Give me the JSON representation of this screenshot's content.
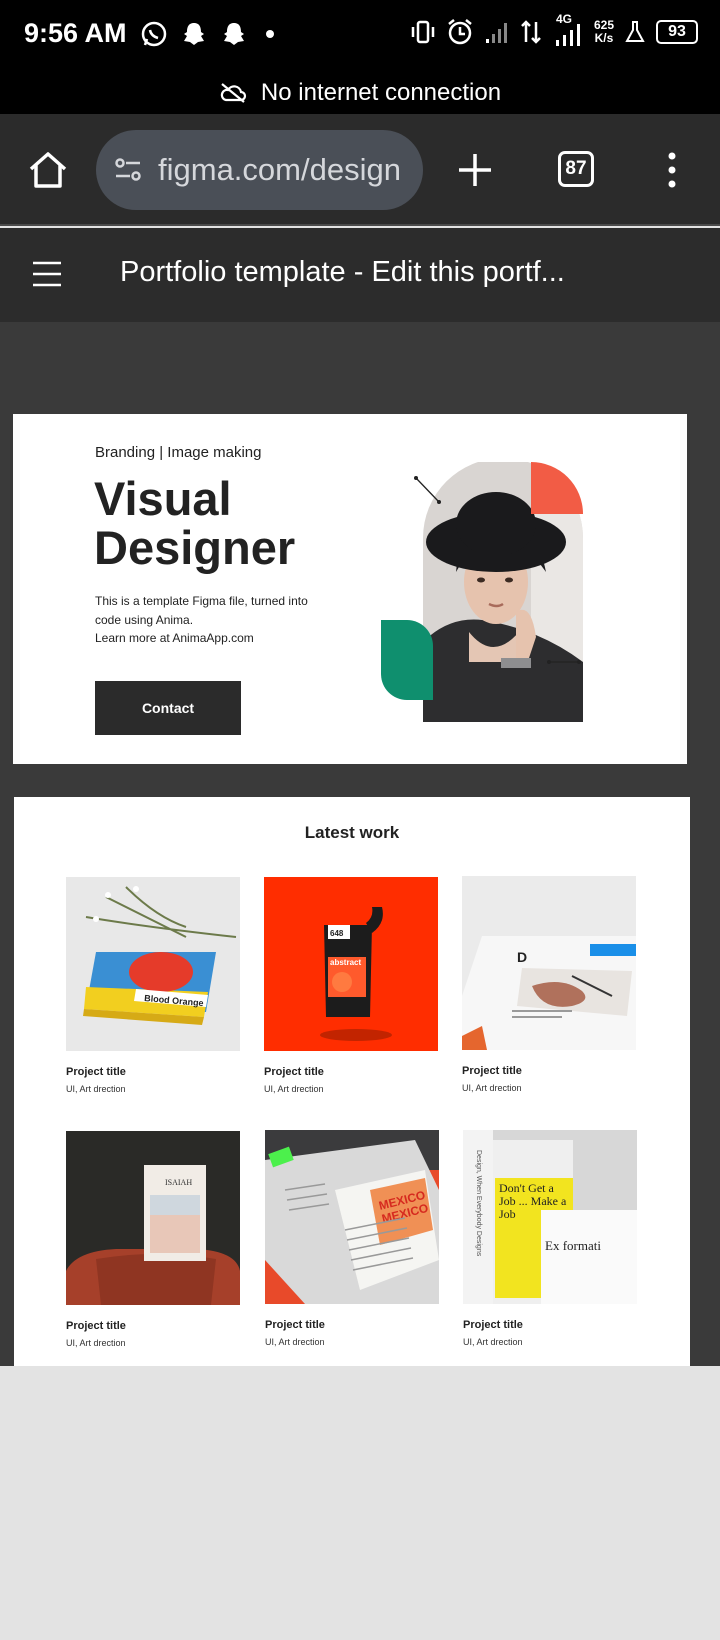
{
  "status_bar": {
    "time": "9:56 AM",
    "network_type": "4G",
    "speed_value": "625",
    "speed_unit": "K/s",
    "battery": "93"
  },
  "connection_banner": {
    "text": "No internet connection"
  },
  "browser": {
    "url": "figma.com/design",
    "tab_count": "87"
  },
  "figma": {
    "file_title": "Portfolio template - Edit this portf..."
  },
  "hero": {
    "eyebrow": "Branding | Image making",
    "heading": "Visual Designer",
    "description": "This is a template Figma file, turned into\ncode using Anima.\nLearn more at AnimaApp.com",
    "contact_label": "Contact"
  },
  "latest_work": {
    "title": "Latest work",
    "projects": [
      {
        "title": "Project title",
        "description": "UI, Art drection",
        "book_label": "Blood Orange"
      },
      {
        "title": "Project title",
        "description": "UI, Art drection",
        "pouch_number": "648",
        "pouch_label": "abstract"
      },
      {
        "title": "Project title",
        "description": "UI, Art drection",
        "page_letter": "D"
      },
      {
        "title": "Project title",
        "description": "UI, Art drection",
        "book_title": "ISAIAH"
      },
      {
        "title": "Project title",
        "description": "UI, Art drection",
        "spread_text": "MEXICO"
      },
      {
        "title": "Project title",
        "description": "UI, Art drection",
        "cover_title": "Don't Get a Job ... Make a Job",
        "spine_text": "Design, When Everybody Designs",
        "side_text": "Ex formati"
      }
    ]
  },
  "colors": {
    "accent_coral": "#f25c45",
    "accent_green": "#0f8f6e",
    "dark": "#2b2b2b",
    "canvas": "#3a3a3a"
  },
  "icons": [
    "whatsapp-icon",
    "snapchat-icon",
    "vibrate-icon",
    "alarm-icon",
    "signal-icon",
    "data-icon",
    "flask-icon",
    "cloud-off-icon",
    "home-icon",
    "tune-icon",
    "plus-icon",
    "more-vert-icon",
    "hamburger-icon"
  ]
}
